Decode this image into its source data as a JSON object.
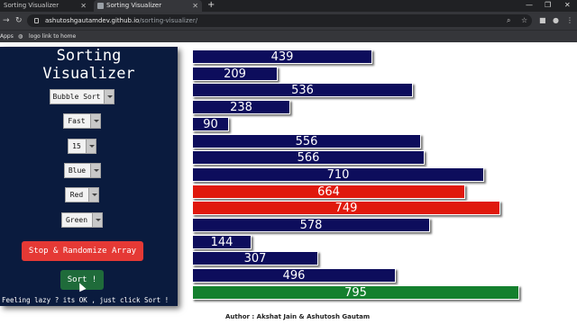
{
  "browser": {
    "tabs": [
      {
        "title": "Sorting Visualizer",
        "active": false
      },
      {
        "title": "Sorting Visualizer",
        "active": true
      }
    ],
    "new_tab_label": "+",
    "url_host": "ashutoshgautamdev.github.io",
    "url_path": "/sorting-visualizer/",
    "bookmarks": [
      "Apps",
      "logo link to home"
    ]
  },
  "sidebar": {
    "title_line1": "Sorting",
    "title_line2": "Visualizer",
    "algorithm": "Bubble Sort",
    "speed": "Fast",
    "size": "15",
    "bar_color": "Blue",
    "compare_color": "Red",
    "sorted_color": "Green",
    "randomize_label": "Stop & Randomize Array",
    "sort_label": "Sort !",
    "lazy_text": "Feeling lazy ? its OK , just click Sort !"
  },
  "bar_colors": {
    "default": "#0d0d5c",
    "compare": "#e0190d",
    "sorted": "#14802e"
  },
  "bars": [
    {
      "value": 439,
      "state": "default"
    },
    {
      "value": 209,
      "state": "default"
    },
    {
      "value": 536,
      "state": "default"
    },
    {
      "value": 238,
      "state": "default"
    },
    {
      "value": 90,
      "state": "default"
    },
    {
      "value": 556,
      "state": "default"
    },
    {
      "value": 566,
      "state": "default"
    },
    {
      "value": 710,
      "state": "default"
    },
    {
      "value": 664,
      "state": "compare"
    },
    {
      "value": 749,
      "state": "compare"
    },
    {
      "value": 578,
      "state": "default"
    },
    {
      "value": 144,
      "state": "default"
    },
    {
      "value": 307,
      "state": "default"
    },
    {
      "value": 496,
      "state": "default"
    },
    {
      "value": 795,
      "state": "sorted"
    }
  ],
  "author": "Author : Akshat Jain & Ashutosh Gautam"
}
